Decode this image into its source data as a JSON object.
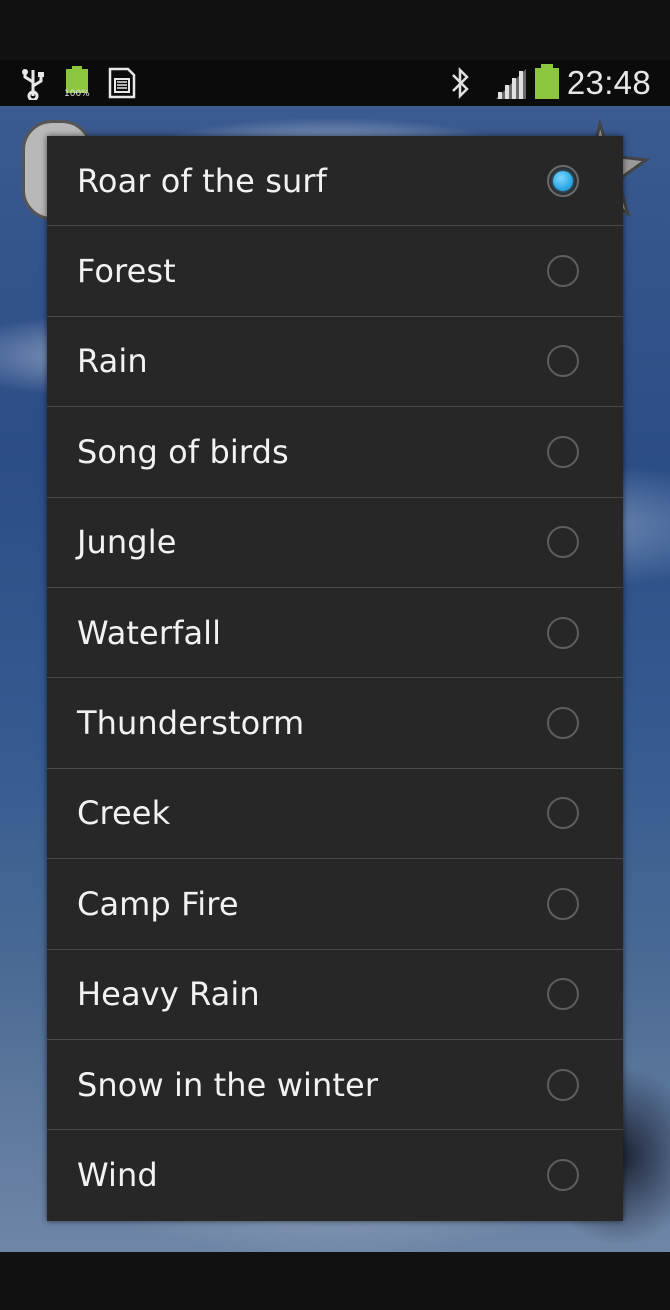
{
  "status_bar": {
    "time": "23:48",
    "battery_small_text": "100%",
    "icons": [
      "usb-icon",
      "battery-100-icon",
      "sd-card-icon",
      "bluetooth-icon",
      "signal-icon",
      "battery-icon"
    ]
  },
  "dialog": {
    "options": [
      {
        "label": "Roar of the surf",
        "checked": true
      },
      {
        "label": "Forest",
        "checked": false
      },
      {
        "label": "Rain",
        "checked": false
      },
      {
        "label": "Song of birds",
        "checked": false
      },
      {
        "label": "Jungle",
        "checked": false
      },
      {
        "label": "Waterfall",
        "checked": false
      },
      {
        "label": "Thunderstorm",
        "checked": false
      },
      {
        "label": "Creek",
        "checked": false
      },
      {
        "label": "Camp Fire",
        "checked": false
      },
      {
        "label": "Heavy Rain",
        "checked": false
      },
      {
        "label": "Snow in the winter",
        "checked": false
      },
      {
        "label": "Wind",
        "checked": false
      }
    ]
  },
  "colors": {
    "accent": "#2fa9e6",
    "dialog_bg": "#272727",
    "divider": "#474747",
    "battery_green": "#8cc63f"
  }
}
